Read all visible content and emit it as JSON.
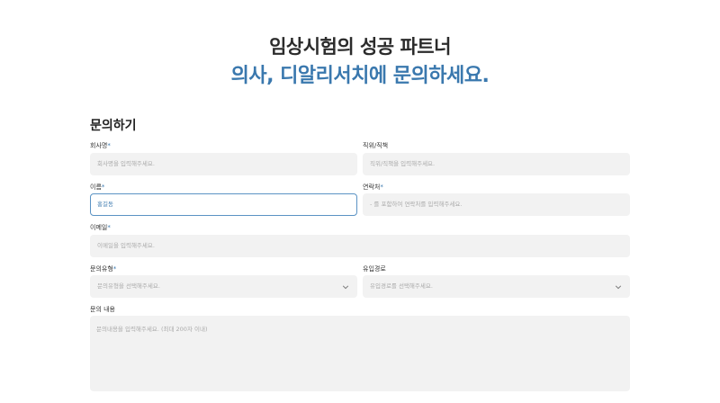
{
  "hero": {
    "line1": "임상시험의 성공 파트너",
    "line2": "의사, 디알리서치에 문의하세요."
  },
  "form": {
    "title": "문의하기",
    "required_mark": "*",
    "company": {
      "label": "회사명",
      "placeholder": "회사명을 입력해주세요."
    },
    "position": {
      "label": "직위/직책",
      "placeholder": "직위/직책을 입력해주세요."
    },
    "name": {
      "label": "이름",
      "value": "홍길동"
    },
    "phone": {
      "label": "연락처",
      "placeholder": "- 를 포함하여 연락처를 입력해주세요."
    },
    "email": {
      "label": "이메일",
      "placeholder": "이메일을 입력해주세요."
    },
    "inquiry_type": {
      "label": "문의유형",
      "placeholder": "문의유형을 선택해주세요."
    },
    "source": {
      "label": "유입경로",
      "placeholder": "유입경로를 선택해주세요."
    },
    "content": {
      "label": "문의 내용",
      "placeholder": "문의내용을 입력해주세요. (최대 200자 이내)"
    }
  },
  "colors": {
    "accent": "#3a78ae",
    "field_bg": "#f2f2f2",
    "active_border": "#5b93c4"
  },
  "icons": {
    "select_arrow": "chevron-down-icon"
  }
}
